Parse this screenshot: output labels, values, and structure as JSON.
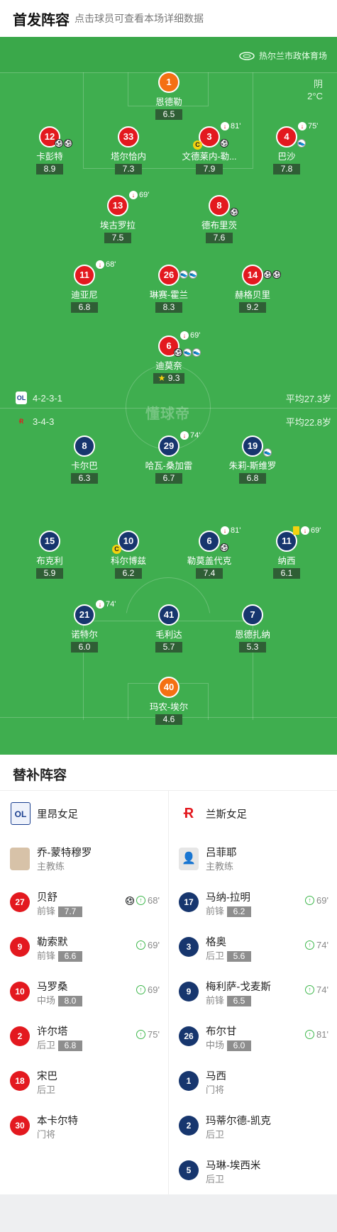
{
  "header": {
    "title": "首发阵容",
    "subtitle": "点击球员可查看本场详细数据"
  },
  "venue": "热尔兰市政体育场",
  "weather": {
    "condition": "阴",
    "temp": "2°C"
  },
  "watermark": "懂球帝",
  "home": {
    "formation": "4-2-3-1",
    "avg_age": "平均27.3岁"
  },
  "away": {
    "formation": "3-4-3",
    "avg_age": "平均22.8岁"
  },
  "players_home": [
    {
      "num": "1",
      "name": "恩德勒",
      "rating": "6.5"
    },
    {
      "num": "12",
      "name": "卡彭特",
      "rating": "8.9"
    },
    {
      "num": "33",
      "name": "塔尔恰内",
      "rating": "7.3"
    },
    {
      "num": "3",
      "name": "文德莱内-勒...",
      "rating": "7.9",
      "sub": "81'"
    },
    {
      "num": "4",
      "name": "巴沙",
      "rating": "7.8",
      "sub": "75'"
    },
    {
      "num": "13",
      "name": "埃古罗拉",
      "rating": "7.5",
      "sub": "69'"
    },
    {
      "num": "8",
      "name": "德布里茨",
      "rating": "7.6"
    },
    {
      "num": "11",
      "name": "迪亚尼",
      "rating": "6.8",
      "sub": "68'"
    },
    {
      "num": "26",
      "name": "琳赛-霍兰",
      "rating": "8.3"
    },
    {
      "num": "14",
      "name": "赫格贝里",
      "rating": "9.2"
    },
    {
      "num": "6",
      "name": "迪莫奈",
      "rating": "9.3",
      "sub": "69'"
    }
  ],
  "players_away": [
    {
      "num": "8",
      "name": "卡尔巴",
      "rating": "6.3"
    },
    {
      "num": "29",
      "name": "哈瓦-桑加雷",
      "rating": "6.7",
      "sub": "74'"
    },
    {
      "num": "19",
      "name": "朱莉-斯维罗",
      "rating": "6.8"
    },
    {
      "num": "15",
      "name": "布克利",
      "rating": "5.9"
    },
    {
      "num": "10",
      "name": "科尔博兹",
      "rating": "6.2"
    },
    {
      "num": "6",
      "name": "勒莫盖代克",
      "rating": "7.4",
      "sub": "81'"
    },
    {
      "num": "11",
      "name": "纳西",
      "rating": "6.1",
      "sub": "69'"
    },
    {
      "num": "21",
      "name": "诺特尔",
      "rating": "6.0",
      "sub": "74'"
    },
    {
      "num": "41",
      "name": "毛利达",
      "rating": "5.7"
    },
    {
      "num": "7",
      "name": "恩德扎纳",
      "rating": "5.3"
    },
    {
      "num": "40",
      "name": "玛农-埃尔",
      "rating": "4.6"
    }
  ],
  "bench": {
    "title": "替补阵容",
    "home_team": "里昂女足",
    "away_team": "兰斯女足",
    "home_coach": {
      "name": "乔-蒙特穆罗",
      "role": "主教练"
    },
    "away_coach": {
      "name": "吕菲耶",
      "role": "主教练"
    },
    "home_subs": [
      {
        "num": "27",
        "name": "贝舒",
        "pos": "前锋",
        "rating": "7.7",
        "time": "68'"
      },
      {
        "num": "9",
        "name": "勒索默",
        "pos": "前锋",
        "rating": "6.6",
        "time": "69'"
      },
      {
        "num": "10",
        "name": "马罗桑",
        "pos": "中场",
        "rating": "8.0",
        "time": "69'"
      },
      {
        "num": "2",
        "name": "许尔塔",
        "pos": "后卫",
        "rating": "6.8",
        "time": "75'"
      },
      {
        "num": "18",
        "name": "宋巴",
        "pos": "后卫"
      },
      {
        "num": "30",
        "name": "本卡尔特",
        "pos": "门将"
      }
    ],
    "away_subs": [
      {
        "num": "17",
        "name": "马纳-拉明",
        "pos": "前锋",
        "rating": "6.2",
        "time": "69'"
      },
      {
        "num": "3",
        "name": "格奥",
        "pos": "后卫",
        "rating": "5.6",
        "time": "74'"
      },
      {
        "num": "9",
        "name": "梅利萨-戈麦斯",
        "pos": "前锋",
        "rating": "6.5",
        "time": "74'"
      },
      {
        "num": "26",
        "name": "布尔甘",
        "pos": "中场",
        "rating": "6.0",
        "time": "81'"
      },
      {
        "num": "1",
        "name": "马西",
        "pos": "门将"
      },
      {
        "num": "2",
        "name": "玛蒂尔德-凯克",
        "pos": "后卫"
      },
      {
        "num": "5",
        "name": "马琳-埃西米",
        "pos": "后卫"
      }
    ]
  }
}
